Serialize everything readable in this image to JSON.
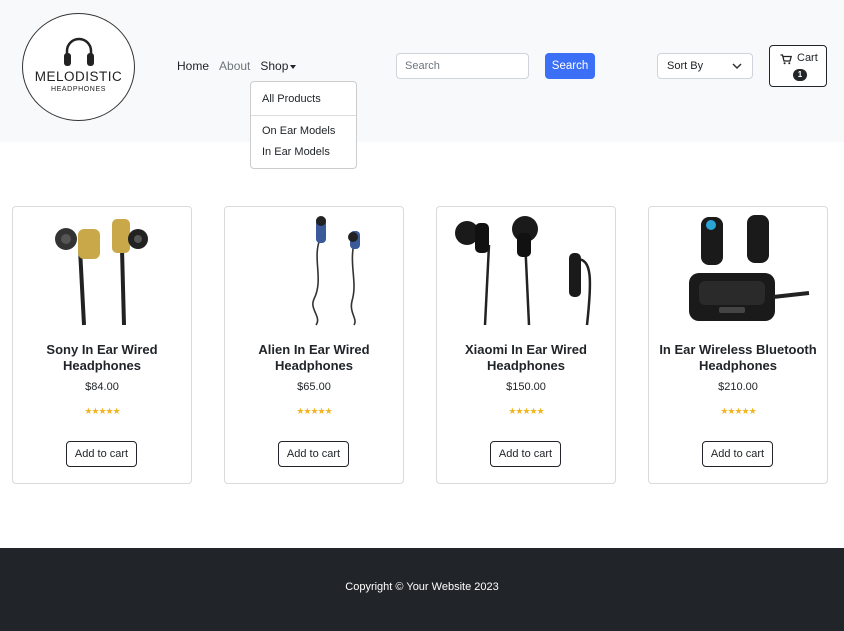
{
  "brand": {
    "name": "MELODISTIC",
    "tagline": "HEADPHONES"
  },
  "nav": {
    "home": "Home",
    "about": "About",
    "shop": "Shop"
  },
  "dropdown": {
    "items": [
      "All Products",
      "On Ear Models",
      "In Ear Models"
    ]
  },
  "search": {
    "placeholder": "Search",
    "value": "",
    "button": "Search"
  },
  "sort": {
    "label": "Sort By"
  },
  "cart": {
    "label": "Cart",
    "count": "1"
  },
  "products": [
    {
      "title": "Sony In Ear Wired Headphones",
      "price": "$84.00",
      "rating": 5,
      "button": "Add to cart",
      "image_icon": "gold-earbuds-icon"
    },
    {
      "title": "Alien In Ear Wired Headphones",
      "price": "$65.00",
      "rating": 5,
      "button": "Add to cart",
      "image_icon": "blue-earbuds-icon"
    },
    {
      "title": "Xiaomi In Ear Wired Headphones",
      "price": "$150.00",
      "rating": 5,
      "button": "Add to cart",
      "image_icon": "black-earbuds-icon"
    },
    {
      "title": "In Ear Wireless Bluetooth Headphones",
      "price": "$210.00",
      "rating": 5,
      "button": "Add to cart",
      "image_icon": "wireless-earbuds-case-icon"
    }
  ],
  "stars": "★★★★★",
  "footer": {
    "copyright": "Copyright © Your Website 2023"
  },
  "colors": {
    "accent": "#3b6ff5",
    "star": "#f0b521",
    "footer_bg": "#212529",
    "header_bg": "#f8f9fa"
  }
}
